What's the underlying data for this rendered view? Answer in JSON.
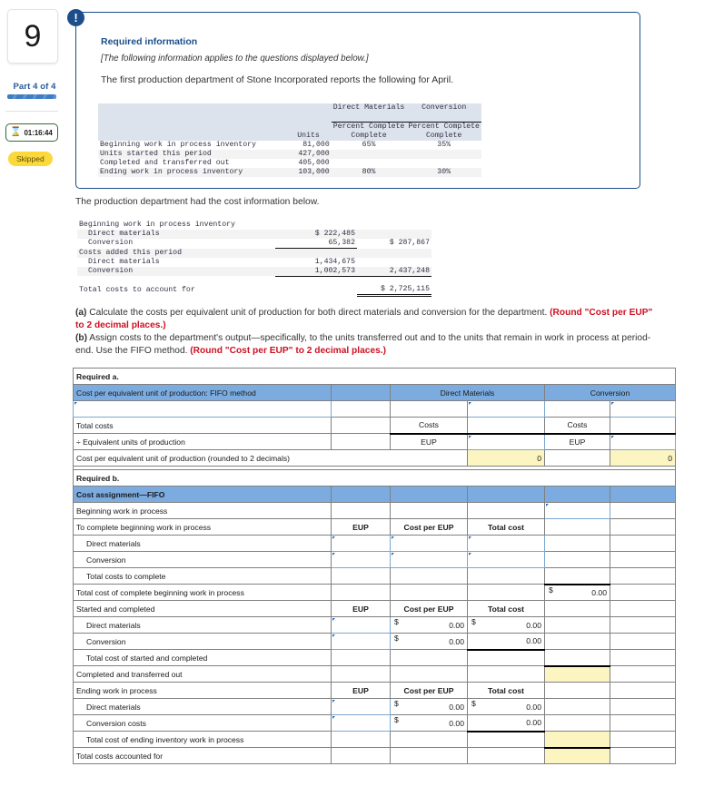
{
  "rail": {
    "question_number": "9",
    "part_label": "Part 4 of 4",
    "timer_icon": "hourglass-icon",
    "timer": "01:16:44",
    "status": "Skipped"
  },
  "callout": {
    "badge": "!",
    "title": "Required information",
    "subtitle": "[The following information applies to the questions displayed below.]",
    "body": "The first production department of Stone Incorporated reports the following for April.",
    "units_table": {
      "group_headers": [
        "Direct Materials",
        "Conversion"
      ],
      "column_headers": [
        "",
        "Units",
        "Percent Complete",
        "Percent Complete"
      ],
      "rows": [
        {
          "label": "Beginning work in process inventory",
          "units": "81,000",
          "dm": "65%",
          "cv": "35%"
        },
        {
          "label": "Units started this period",
          "units": "427,000",
          "dm": "",
          "cv": ""
        },
        {
          "label": "Completed and transferred out",
          "units": "405,000",
          "dm": "",
          "cv": ""
        },
        {
          "label": "Ending work in process inventory",
          "units": "103,000",
          "dm": "80%",
          "cv": "30%"
        }
      ]
    }
  },
  "cost_info": {
    "intro": "The production department had the cost information below.",
    "rows": [
      {
        "label": "Beginning work in process inventory",
        "col1": "",
        "col2": ""
      },
      {
        "label": "Direct materials",
        "col1": "$ 222,485",
        "col2": ""
      },
      {
        "label": "Conversion",
        "col1": "65,382",
        "col2": "$ 287,867"
      },
      {
        "label": "Costs added this period",
        "col1": "",
        "col2": ""
      },
      {
        "label": "Direct materials",
        "col1": "1,434,675",
        "col2": ""
      },
      {
        "label": "Conversion",
        "col1": "1,002,573",
        "col2": "2,437,248"
      },
      {
        "label": "Total costs to account for",
        "col1": "",
        "col2": "$ 2,725,115"
      }
    ]
  },
  "requirements": {
    "a_prefix": "(a)",
    "a_text": " Calculate the costs per equivalent unit of production for both direct materials and conversion for the department. ",
    "a_note": "(Round \"Cost per EUP\" to 2 decimal places.)",
    "b_prefix": "(b)",
    "b_text": " Assign costs to the department's output—specifically, to the units transferred out and to the units that remain in work in process at period-end. Use the FIFO method. ",
    "b_note": "(Round \"Cost per EUP\" to 2 decimal places.)"
  },
  "required_a": {
    "section_title": "Required a.",
    "header_label": "Cost per equivalent unit of production: FIFO method",
    "group_dm": "Direct Materials",
    "group_cv": "Conversion",
    "rows": [
      {
        "label": "",
        "c_dm_lbl": "",
        "c_dm_val": "",
        "c_cv_lbl": "",
        "c_cv_val": ""
      },
      {
        "label": "Total costs",
        "c_dm_lbl": "Costs",
        "c_dm_val": "",
        "c_cv_lbl": "Costs",
        "c_cv_val": ""
      },
      {
        "label": "÷ Equivalent units of production",
        "c_dm_lbl": "EUP",
        "c_dm_val": "",
        "c_cv_lbl": "EUP",
        "c_cv_val": ""
      },
      {
        "label": "Cost per equivalent unit of production (rounded to 2 decimals)",
        "c_dm_lbl": "",
        "c_dm_val": "0",
        "c_cv_lbl": "",
        "c_cv_val": "0"
      }
    ]
  },
  "required_b": {
    "section_title": "Required b.",
    "header_label": "Cost assignment—FIFO",
    "col_eup": "EUP",
    "col_cost_per_eup": "Cost per EUP",
    "col_total_cost": "Total cost",
    "rows": [
      {
        "label": "Beginning work in process",
        "indent": 0,
        "eup": "",
        "cpe": "",
        "tc": "",
        "ext": ""
      },
      {
        "label": "To complete beginning work in process",
        "indent": 0,
        "eup": "EUP",
        "cpe": "Cost per EUP",
        "tc": "Total cost",
        "ext": ""
      },
      {
        "label": "Direct materials",
        "indent": 1,
        "eup": "",
        "cpe": "",
        "tc": "",
        "ext": ""
      },
      {
        "label": "Conversion",
        "indent": 1,
        "eup": "",
        "cpe": "",
        "tc": "",
        "ext": ""
      },
      {
        "label": "Total costs to complete",
        "indent": 1,
        "eup": "",
        "cpe": "",
        "tc": "",
        "ext": ""
      },
      {
        "label": "Total cost of complete beginning work in process",
        "indent": 0,
        "eup": "",
        "cpe": "",
        "tc": "",
        "ext": "0.00"
      },
      {
        "label": "Started and completed",
        "indent": 0,
        "eup": "EUP",
        "cpe": "Cost per EUP",
        "tc": "Total cost",
        "ext": ""
      },
      {
        "label": "Direct materials",
        "indent": 1,
        "eup": "",
        "cpe": "0.00",
        "tc": "0.00",
        "ext": ""
      },
      {
        "label": "Conversion",
        "indent": 1,
        "eup": "",
        "cpe": "0.00",
        "tc": "0.00",
        "ext": ""
      },
      {
        "label": "Total cost of started and completed",
        "indent": 1,
        "eup": "",
        "cpe": "",
        "tc": "",
        "ext": ""
      },
      {
        "label": "Completed and transferred out",
        "indent": 0,
        "eup": "",
        "cpe": "",
        "tc": "",
        "ext": ""
      },
      {
        "label": "Ending work in process",
        "indent": 0,
        "eup": "EUP",
        "cpe": "Cost per EUP",
        "tc": "Total cost",
        "ext": ""
      },
      {
        "label": "Direct materials",
        "indent": 1,
        "eup": "",
        "cpe": "0.00",
        "tc": "0.00",
        "ext": ""
      },
      {
        "label": "Conversion costs",
        "indent": 1,
        "eup": "",
        "cpe": "0.00",
        "tc": "0.00",
        "ext": ""
      },
      {
        "label": "Total cost of ending inventory work in process",
        "indent": 1,
        "eup": "",
        "cpe": "",
        "tc": "",
        "ext": ""
      },
      {
        "label": "Total costs accounted for",
        "indent": 0,
        "eup": "",
        "cpe": "",
        "tc": "",
        "ext": ""
      }
    ],
    "dollar_symbol": "$"
  },
  "colors": {
    "accent_blue": "#1b4e8a",
    "header_blue": "#7cacdf",
    "answer_yellow": "#fcf5c2",
    "warning_red": "#cc1122",
    "skipped_yellow": "#fcd93b",
    "timer_green": "#2f6b34"
  }
}
